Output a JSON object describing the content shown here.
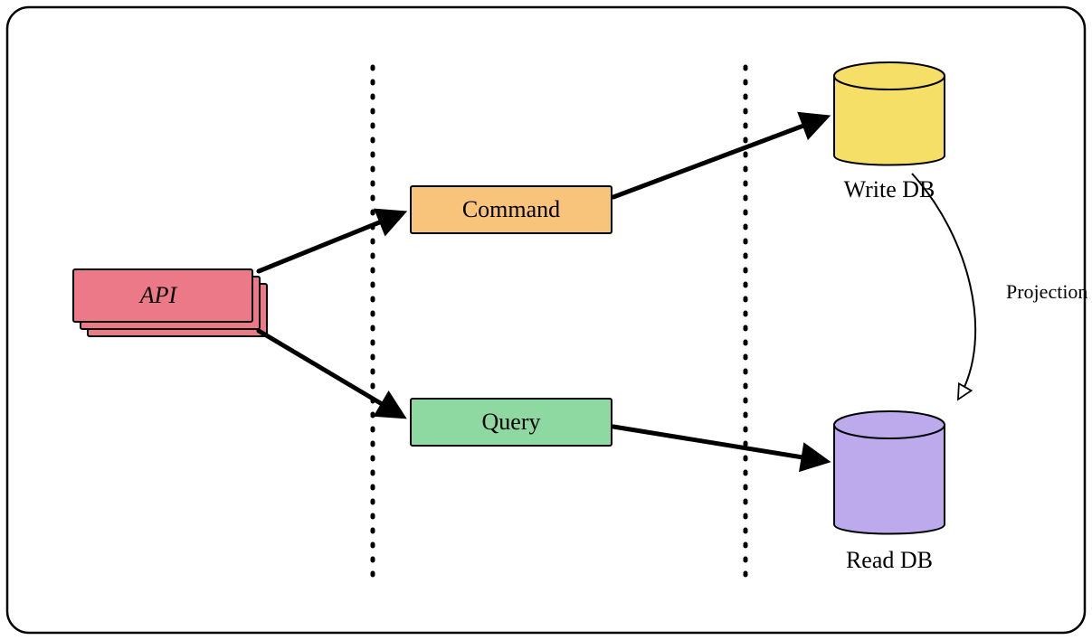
{
  "diagram": {
    "nodes": {
      "api": {
        "label": "API",
        "fill": "#ec7987",
        "stroke": "#000000"
      },
      "command": {
        "label": "Command",
        "fill": "#f8c37a",
        "stroke": "#000000"
      },
      "query": {
        "label": "Query",
        "fill": "#8ed9a2",
        "stroke": "#000000"
      },
      "write_db": {
        "label": "Write DB",
        "fill": "#f5df66",
        "stroke": "#000000"
      },
      "read_db": {
        "label": "Read DB",
        "fill": "#bdaaed",
        "stroke": "#000000"
      }
    },
    "edges": {
      "projection": {
        "label": "Projection"
      }
    }
  }
}
